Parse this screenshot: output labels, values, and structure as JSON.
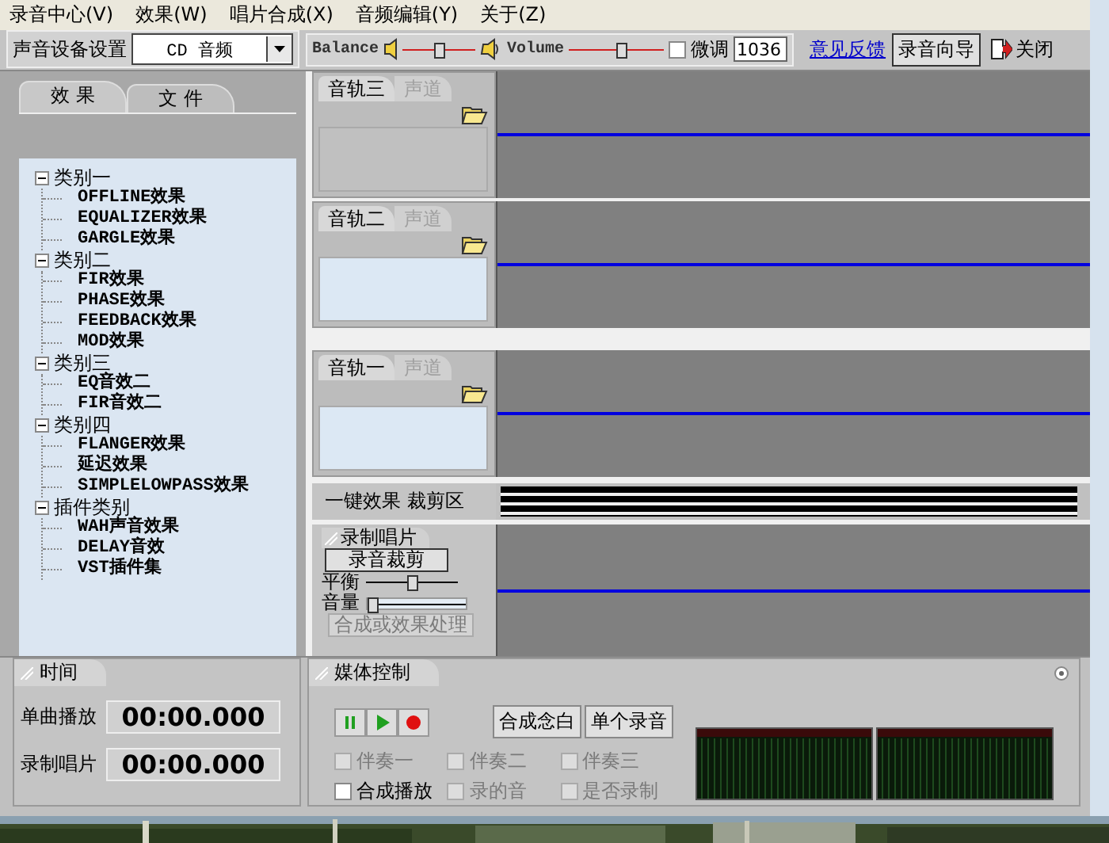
{
  "menu": [
    {
      "label": "录音中心(V)"
    },
    {
      "label": "效果(W)"
    },
    {
      "label": "唱片合成(X)"
    },
    {
      "label": "音频编辑(Y)"
    },
    {
      "label": "关于(Z)"
    }
  ],
  "toolbar": {
    "device_label": "声音设备设置",
    "device": {
      "value": "CD 音频"
    },
    "balance": {
      "label": "Balance",
      "level": 0.5
    },
    "volume": {
      "label": "Volume",
      "level": 0.55
    },
    "fine_tune": {
      "label": "微调",
      "checked": false,
      "value": "1036"
    },
    "feedback_link": "意见反馈",
    "wizard_button": "录音向导",
    "close_button": "关闭"
  },
  "left_panel": {
    "tabs": [
      {
        "label": "效 果",
        "selected": true
      },
      {
        "label": "文 件",
        "selected": false
      }
    ],
    "tree": [
      {
        "label": "类别一",
        "expanded": true,
        "children": [
          {
            "label": "OFFLINE效果"
          },
          {
            "label": "EQUALIZER效果"
          },
          {
            "label": "GARGLE效果"
          }
        ]
      },
      {
        "label": "类别二",
        "expanded": true,
        "children": [
          {
            "label": "FIR效果"
          },
          {
            "label": "PHASE效果"
          },
          {
            "label": "FEEDBACK效果"
          },
          {
            "label": "MOD效果"
          }
        ]
      },
      {
        "label": "类别三",
        "expanded": true,
        "children": [
          {
            "label": "EQ音效二"
          },
          {
            "label": "FIR音效二"
          }
        ]
      },
      {
        "label": "类别四",
        "expanded": true,
        "children": [
          {
            "label": "FLANGER效果"
          },
          {
            "label": "延迟效果"
          },
          {
            "label": "SIMPLELOWPASS效果"
          }
        ]
      },
      {
        "label": "插件类别",
        "expanded": true,
        "children": [
          {
            "label": "WAH声音效果"
          },
          {
            "label": "DELAY音效"
          },
          {
            "label": "VST插件集"
          }
        ]
      }
    ]
  },
  "tracks": [
    {
      "tabs": [
        {
          "label": "音轨三",
          "selected": true
        },
        {
          "label": "声道",
          "selected": false
        }
      ],
      "enabled": false
    },
    {
      "tabs": [
        {
          "label": "音轨二",
          "selected": true
        },
        {
          "label": "声道",
          "selected": false
        }
      ],
      "enabled": true
    },
    {
      "tabs": [
        {
          "label": "音轨一",
          "selected": true
        },
        {
          "label": "声道",
          "selected": false
        }
      ],
      "enabled": true
    }
  ],
  "effects_row": {
    "label": "一键效果 裁剪区"
  },
  "record_panel": {
    "title": "录制唱片",
    "trim_button": "录音裁剪",
    "balance": {
      "label": "平衡",
      "level": 0.5
    },
    "volume": {
      "label": "音量",
      "level": 0.05
    },
    "process_button": {
      "label": "合成或效果处理",
      "disabled": true
    }
  },
  "time_panel": {
    "title": "时间",
    "rows": [
      {
        "label": "单曲播放",
        "value": "00:00.000"
      },
      {
        "label": "录制唱片",
        "value": "00:00.000"
      }
    ]
  },
  "media_panel": {
    "title": "媒体控制",
    "transport": [
      {
        "kind": "pause"
      },
      {
        "kind": "play"
      },
      {
        "kind": "record"
      }
    ],
    "buttons": [
      "合成念白",
      "单个录音"
    ],
    "options": [
      {
        "label": "伴奏一",
        "checked": false,
        "disabled": true
      },
      {
        "label": "伴奏二",
        "checked": false,
        "disabled": true
      },
      {
        "label": "伴奏三",
        "checked": false,
        "disabled": true
      },
      {
        "label": "合成播放",
        "checked": false,
        "disabled": false
      },
      {
        "label": "录的音",
        "checked": false,
        "disabled": true
      },
      {
        "label": "是否录制",
        "checked": false,
        "disabled": true
      }
    ]
  }
}
